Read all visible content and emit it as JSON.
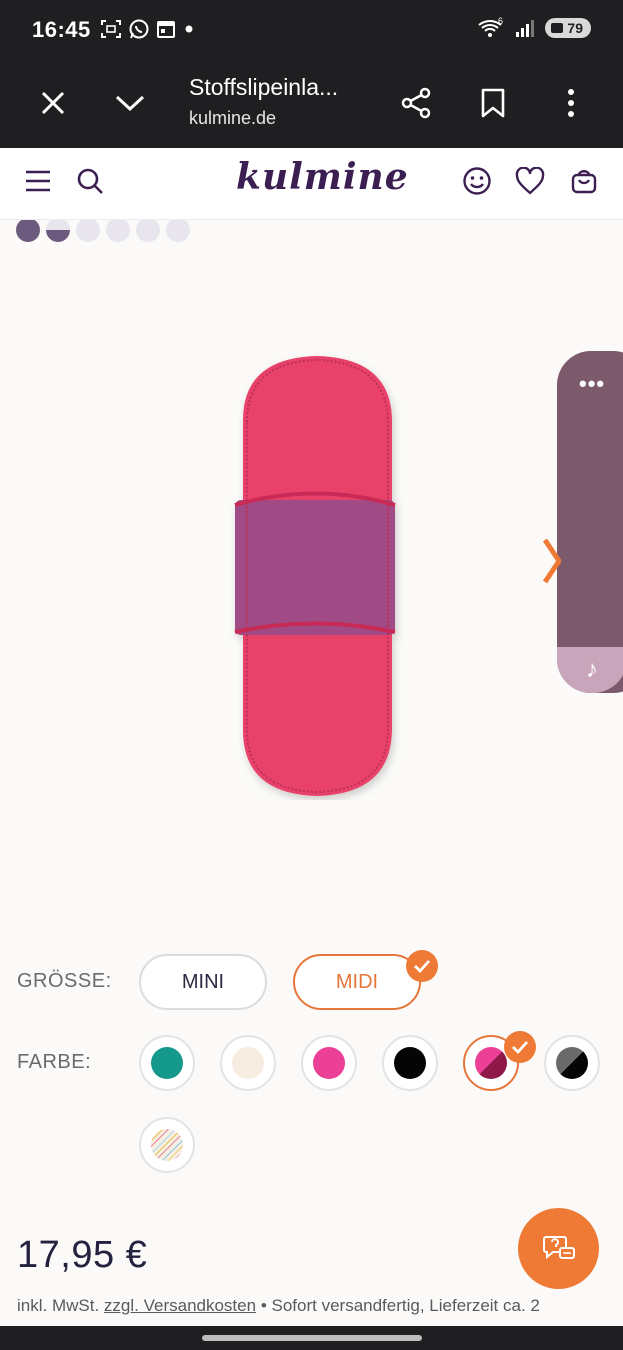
{
  "status_bar": {
    "time": "16:45",
    "network": "6",
    "battery": "79"
  },
  "browser": {
    "title": "Stoffslipeinla...",
    "url": "kulmine.de"
  },
  "site": {
    "logo": "kulmine"
  },
  "gallery": {
    "dot_count": 6,
    "active_index": 0
  },
  "product_options": {
    "size_label": "GRÖSSE:",
    "sizes": [
      {
        "label": "MINI",
        "selected": false
      },
      {
        "label": "MIDI",
        "selected": true
      }
    ],
    "color_label": "FARBE:",
    "colors": [
      {
        "name": "petrol",
        "color": "#15998c",
        "selected": false
      },
      {
        "name": "natur",
        "color": "#f6ece0",
        "selected": false
      },
      {
        "name": "pink",
        "color": "#ec3f96",
        "selected": false
      },
      {
        "name": "schwarz",
        "color": "#050505",
        "selected": false
      },
      {
        "name": "pink-beere",
        "color": "#c81f6a",
        "selected": true
      },
      {
        "name": "grau-schwarz",
        "color": "#4a4a4a",
        "selected": false
      },
      {
        "name": "gestreift",
        "color": "#f5eee2",
        "selected": false
      }
    ]
  },
  "price": {
    "amount": "17,95 €",
    "tax_note": "inkl. MwSt.",
    "shipping_link": "zzgl. Versandkosten",
    "separator": "•",
    "availability": "Sofort versandfertig, Lieferzeit ca. 2"
  },
  "colors": {
    "accent_orange": "#ef7a36",
    "brand_purple": "#3c1f52",
    "panel_mauve": "#7c5a6c"
  }
}
